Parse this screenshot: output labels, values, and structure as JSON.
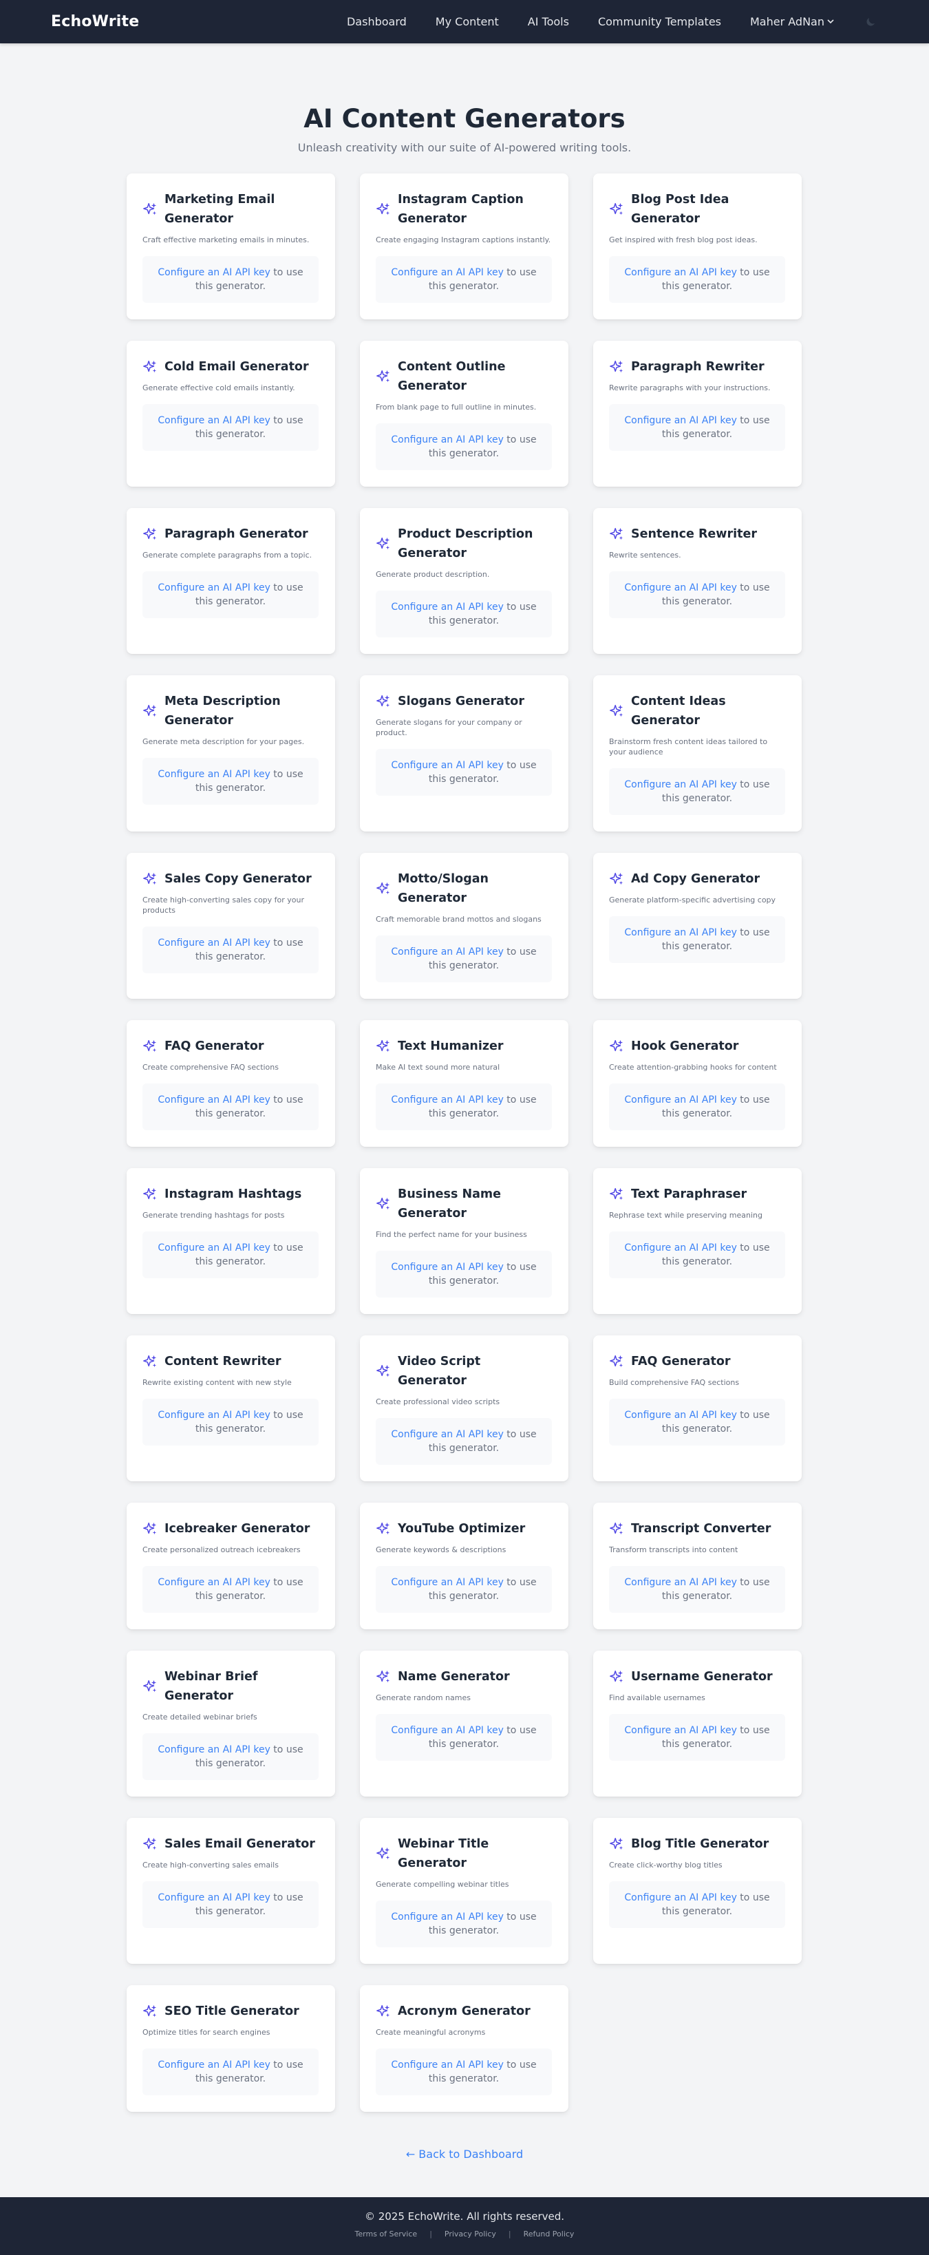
{
  "nav": {
    "brand": "EchoWrite",
    "links": [
      "Dashboard",
      "My Content",
      "AI Tools",
      "Community Templates"
    ],
    "user": "Maher AdNan",
    "user_icon": "chevron-down-icon",
    "theme_icon": "moon-icon"
  },
  "page": {
    "title": "AI Content Generators",
    "subtitle": "Unleash creativity with our suite of AI-powered writing tools."
  },
  "card_common": {
    "icon": "sparkles-icon",
    "api_link": "Configure an AI API key",
    "api_rest": " to use this generator."
  },
  "cards": [
    {
      "title": "Marketing Email Generator",
      "desc": "Craft effective marketing emails in minutes."
    },
    {
      "title": "Instagram Caption Generator",
      "desc": "Create engaging Instagram captions instantly."
    },
    {
      "title": "Blog Post Idea Generator",
      "desc": "Get inspired with fresh blog post ideas."
    },
    {
      "title": "Cold Email Generator",
      "desc": "Generate effective cold emails instantly."
    },
    {
      "title": "Content Outline Generator",
      "desc": "From blank page to full outline in minutes."
    },
    {
      "title": "Paragraph Rewriter",
      "desc": "Rewrite paragraphs with your instructions."
    },
    {
      "title": "Paragraph Generator",
      "desc": "Generate complete paragraphs from a topic."
    },
    {
      "title": "Product Description Generator",
      "desc": "Generate product description."
    },
    {
      "title": "Sentence Rewriter",
      "desc": "Rewrite sentences."
    },
    {
      "title": "Meta Description Generator",
      "desc": "Generate meta description for your pages."
    },
    {
      "title": "Slogans Generator",
      "desc": "Generate slogans for your company or product."
    },
    {
      "title": "Content Ideas Generator",
      "desc": "Brainstorm fresh content ideas tailored to your audience"
    },
    {
      "title": "Sales Copy Generator",
      "desc": "Create high-converting sales copy for your products"
    },
    {
      "title": "Motto/Slogan Generator",
      "desc": "Craft memorable brand mottos and slogans"
    },
    {
      "title": "Ad Copy Generator",
      "desc": "Generate platform-specific advertising copy"
    },
    {
      "title": "FAQ Generator",
      "desc": "Create comprehensive FAQ sections"
    },
    {
      "title": "Text Humanizer",
      "desc": "Make AI text sound more natural"
    },
    {
      "title": "Hook Generator",
      "desc": "Create attention-grabbing hooks for content"
    },
    {
      "title": "Instagram Hashtags",
      "desc": "Generate trending hashtags for posts"
    },
    {
      "title": "Business Name Generator",
      "desc": "Find the perfect name for your business"
    },
    {
      "title": "Text Paraphraser",
      "desc": "Rephrase text while preserving meaning"
    },
    {
      "title": "Content Rewriter",
      "desc": "Rewrite existing content with new style"
    },
    {
      "title": "Video Script Generator",
      "desc": "Create professional video scripts"
    },
    {
      "title": "FAQ Generator",
      "desc": "Build comprehensive FAQ sections"
    },
    {
      "title": "Icebreaker Generator",
      "desc": "Create personalized outreach icebreakers"
    },
    {
      "title": "YouTube Optimizer",
      "desc": "Generate keywords & descriptions"
    },
    {
      "title": "Transcript Converter",
      "desc": "Transform transcripts into content"
    },
    {
      "title": "Webinar Brief Generator",
      "desc": "Create detailed webinar briefs"
    },
    {
      "title": "Name Generator",
      "desc": "Generate random names"
    },
    {
      "title": "Username Generator",
      "desc": "Find available usernames"
    },
    {
      "title": "Sales Email Generator",
      "desc": "Create high-converting sales emails"
    },
    {
      "title": "Webinar Title Generator",
      "desc": "Generate compelling webinar titles"
    },
    {
      "title": "Blog Title Generator",
      "desc": "Create click-worthy blog titles"
    },
    {
      "title": "SEO Title Generator",
      "desc": "Optimize titles for search engines"
    },
    {
      "title": "Acronym Generator",
      "desc": "Create meaningful acronyms"
    }
  ],
  "back_link": "← Back to Dashboard",
  "footer": {
    "copyright": "© 2025 EchoWrite. All rights reserved.",
    "links": [
      "Terms of Service",
      "Privacy Policy",
      "Refund Policy"
    ],
    "separator": "|"
  },
  "colors": {
    "nav_bg": "#1e2536",
    "page_bg": "#f3f4f6",
    "accent_link": "#3b82f6",
    "icon": "#4f46e5"
  }
}
